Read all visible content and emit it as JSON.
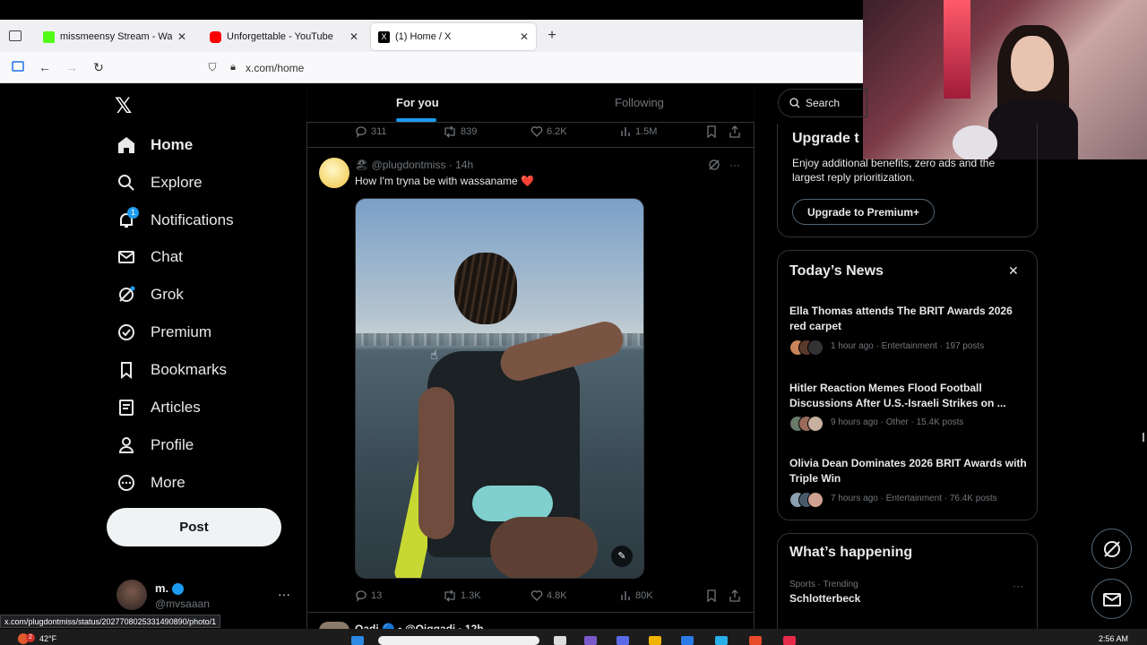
{
  "browser": {
    "tabs": [
      {
        "title": "missmeensy Stream - Watch Liv",
        "close": "✕",
        "color": "#53fc18"
      },
      {
        "title": "Unforgettable - YouTube",
        "close": "✕",
        "color": "#ff0000"
      },
      {
        "title": "(1) Home / X",
        "close": "✕",
        "color": "#000000"
      }
    ],
    "new_tab": "+",
    "url": "x.com/home",
    "status_url": "x.com/plugdontmiss/status/2027708025331490890/photo/1"
  },
  "sidebar": {
    "logo": "𝕏",
    "items": [
      {
        "label": "Home",
        "icon": "home-icon"
      },
      {
        "label": "Explore",
        "icon": "search-icon"
      },
      {
        "label": "Notifications",
        "icon": "bell-icon",
        "badge": "1"
      },
      {
        "label": "Chat",
        "icon": "mail-icon"
      },
      {
        "label": "Grok",
        "icon": "grok-icon"
      },
      {
        "label": "Premium",
        "icon": "verified-icon"
      },
      {
        "label": "Bookmarks",
        "icon": "bookmark-icon"
      },
      {
        "label": "Articles",
        "icon": "articles-icon"
      },
      {
        "label": "Profile",
        "icon": "person-icon"
      },
      {
        "label": "More",
        "icon": "more-circle-icon"
      }
    ],
    "post_button": "Post",
    "account": {
      "name": "m.",
      "handle": "@mvsaaan",
      "more": "···"
    }
  },
  "feed": {
    "tabs": [
      "For you",
      "Following"
    ],
    "prev_metrics": {
      "replies": "311",
      "reposts": "839",
      "likes": "6.2K",
      "views": "1.5M"
    },
    "post": {
      "handle": "🏖 @plugdontmiss · 14h",
      "text": "How I'm tryna be with wassaname ❤️",
      "metrics": {
        "replies": "13",
        "reposts": "1.3K",
        "likes": "4.8K",
        "views": "80K"
      }
    },
    "next_post_handle": "Qadi 🔵 ▪ @Qiqqadi · 12h"
  },
  "right": {
    "search_label": "Search",
    "premium": {
      "title": "Upgrade t",
      "text": "Enjoy additional benefits, zero ads and the largest reply prioritization.",
      "button": "Upgrade to Premium+"
    },
    "news": {
      "title": "Today’s News",
      "close": "✕",
      "items": [
        {
          "title": "Ella Thomas attends The BRIT Awards 2026 red carpet",
          "meta": "1 hour ago · Entertainment · 197 posts"
        },
        {
          "title": "Hitler Reaction Memes Flood Football Discussions After U.S.-Israeli Strikes on ...",
          "meta": "9 hours ago · Other · 15.4K posts"
        },
        {
          "title": "Olivia Dean Dominates 2026 BRIT Awards with Triple Win",
          "meta": "7 hours ago · Entertainment · 76.4K posts"
        }
      ]
    },
    "happening": {
      "title": "What’s happening",
      "trend_meta": "Sports · Trending",
      "trend_name": "Schlotterbeck",
      "more": "···"
    }
  },
  "taskbar": {
    "temp": "42°F",
    "time": "2:56 AM",
    "notif": "2"
  }
}
